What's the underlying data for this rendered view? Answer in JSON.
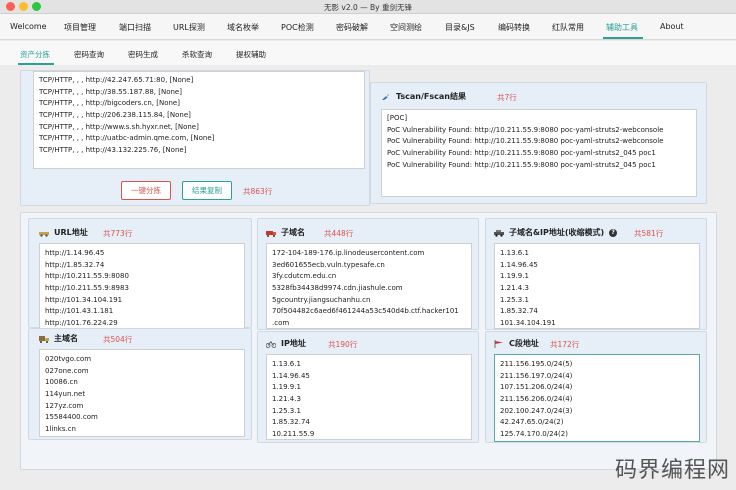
{
  "window": {
    "title": "无影 v2.0 — By 重剑无锋"
  },
  "menu": {
    "items": [
      "Welcome",
      "项目管理",
      "端口扫描",
      "URL探测",
      "域名枚举",
      "POC检测",
      "密码破解",
      "空间测绘",
      "目录&JS",
      "编码转换",
      "红队常用",
      "辅助工具",
      "About"
    ],
    "active": "辅助工具"
  },
  "subtabs": {
    "items": [
      "资产分拣",
      "密码查询",
      "密码生成",
      "杀软查询",
      "提权辅助"
    ],
    "active": "资产分拣"
  },
  "input_panel": {
    "lines": [
      "TCP/HTTP, , , http://42.247.65.71:80, [None]",
      "TCP/HTTP, , , http://38.55.187.88, [None]",
      "TCP/HTTP, , , http://bigcoders.cn, [None]",
      "TCP/HTTP, , , http://206.238.115.84, [None]",
      "TCP/HTTP, , , http://www.s.sh.hyxr.net, [None]",
      "TCP/HTTP, , , http://uatbc-admin.qme.com, [None]",
      "TCP/HTTP, , , http://43.132.225.76, [None]"
    ],
    "sort_button": "一键分拣",
    "copy_button": "结果复制",
    "total": "共863行"
  },
  "tscan": {
    "title": "Tscan/Fscan结果",
    "count": "共7行",
    "lines": [
      "[POC]",
      "PoC Vulnerability Found: http://10.211.55.9:8080 poc-yaml-struts2-webconsole",
      "PoC Vulnerability Found: http://10.211.55.9:8080 poc-yaml-struts2-webconsole",
      "PoC Vulnerability Found: http://10.211.55.9:8080 poc-yaml-struts2_045 poc1",
      "PoC Vulnerability Found: http://10.211.55.9:8080 poc-yaml-struts2_045 poc1"
    ]
  },
  "url_panel": {
    "title": "URL地址",
    "count": "共773行",
    "lines": [
      "http://1.14.96.45",
      "http://1.85.32.74",
      "http://10.211.55.9:8080",
      "http://10.211.55.9:8983",
      "http://101.34.104.191",
      "http://101.43.1.181",
      "http://101.76.224.29"
    ]
  },
  "domain_panel": {
    "title": "主域名",
    "count": "共504行",
    "lines": [
      "020tvgo.com",
      "027one.com",
      "10086.cn",
      "114yun.net",
      "127yz.com",
      "15584400.com",
      "1links.cn"
    ]
  },
  "subdomain_panel": {
    "title": "子域名",
    "count": "共448行",
    "lines": [
      "172-104-189-176.ip.linodeusercontent.com",
      "3ed601655ecb.vuln.typesafe.cn",
      "3fy.cdutcm.edu.cn",
      "5328fb34438d9974.cdn.jiashule.com",
      "5gcountry.jiangsuchanhu.cn",
      "70f504482c6aed6f461244a53c540d4b.ctf.hacker101",
      ".com"
    ]
  },
  "ip_panel": {
    "title": "IP地址",
    "count": "共190行",
    "lines": [
      "1.13.6.1",
      "1.14.96.45",
      "1.19.9.1",
      "1.21.4.3",
      "1.25.3.1",
      "1.85.32.74",
      "10.211.55.9"
    ]
  },
  "subdomain_ip_panel": {
    "title": "子域名&IP地址(收缩模式)",
    "count": "共581行",
    "lines": [
      "1.13.6.1",
      "1.14.96.45",
      "1.19.9.1",
      "1.21.4.3",
      "1.25.3.1",
      "1.85.32.74",
      "101.34.104.191"
    ]
  },
  "c_panel": {
    "title": "C段地址",
    "count": "共172行",
    "lines": [
      "211.156.195.0/24(5)",
      "211.156.197.0/24(4)",
      "107.151.206.0/24(4)",
      "211.156.206.0/24(4)",
      "202.100.247.0/24(3)",
      "42.247.65.0/24(2)",
      "125.74.170.0/24(2)"
    ]
  },
  "watermark": "码界编程网",
  "colors": {
    "accent": "#2aa198",
    "danger": "#d9534f",
    "panel_bg": "#e6eef7"
  },
  "icons": [
    "rocket-icon",
    "vehicle-icon",
    "truck-icon",
    "bicycle-icon",
    "flag-icon",
    "help-icon"
  ]
}
